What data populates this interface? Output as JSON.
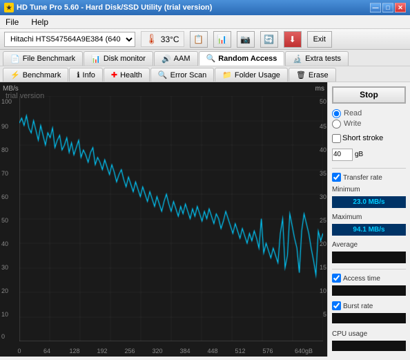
{
  "titleBar": {
    "title": "HD Tune Pro 5.60 - Hard Disk/SSD Utility (trial version)",
    "icon": "★",
    "buttons": [
      "—",
      "□",
      "✕"
    ]
  },
  "menuBar": {
    "items": [
      "File",
      "Help"
    ]
  },
  "toolbar": {
    "driveLabel": "Hitachi HTS547564A9E384 (640 gB)",
    "temperature": "33°C",
    "exitLabel": "Exit"
  },
  "tabsRow1": {
    "tabs": [
      {
        "label": "File Benchmark",
        "icon": "📄"
      },
      {
        "label": "Disk monitor",
        "icon": "📊"
      },
      {
        "label": "AAM",
        "icon": "🔊"
      },
      {
        "label": "Random Access",
        "icon": "🔍",
        "active": true
      },
      {
        "label": "Extra tests",
        "icon": "🔬"
      }
    ]
  },
  "tabsRow2": {
    "tabs": [
      {
        "label": "Benchmark",
        "icon": "⚡"
      },
      {
        "label": "Info",
        "icon": "ℹ"
      },
      {
        "label": "Health",
        "icon": "➕"
      },
      {
        "label": "Error Scan",
        "icon": "🔍"
      },
      {
        "label": "Folder Usage",
        "icon": "📁"
      },
      {
        "label": "Erase",
        "icon": "🗑"
      }
    ]
  },
  "chart": {
    "trialText": "trial version",
    "yLabelLeft": "MB/s",
    "yLabelRight": "ms",
    "yLeftLabels": [
      100,
      90,
      80,
      70,
      60,
      50,
      40,
      30,
      20,
      10,
      0
    ],
    "yRightLabels": [
      50,
      45,
      40,
      35,
      30,
      25,
      20,
      15,
      10,
      5
    ],
    "xLabels": [
      "0",
      "64",
      "128",
      "192",
      "256",
      "320",
      "384",
      "448",
      "512",
      "576",
      "640gB"
    ]
  },
  "rightPanel": {
    "stopLabel": "Stop",
    "readLabel": "Read",
    "writeLabel": "Write",
    "shortStrokeLabel": "Short stroke",
    "shortStrokeValue": "40",
    "gbLabel": "gB",
    "transferRateLabel": "Transfer rate",
    "minimumLabel": "Minimum",
    "minimumValue": "23.0 MB/s",
    "maximumLabel": "Maximum",
    "maximumValue": "94.1 MB/s",
    "averageLabel": "Average",
    "averageValue": "",
    "accessTimeLabel": "Access time",
    "burstRateLabel": "Burst rate",
    "cpuUsageLabel": "CPU usage"
  }
}
